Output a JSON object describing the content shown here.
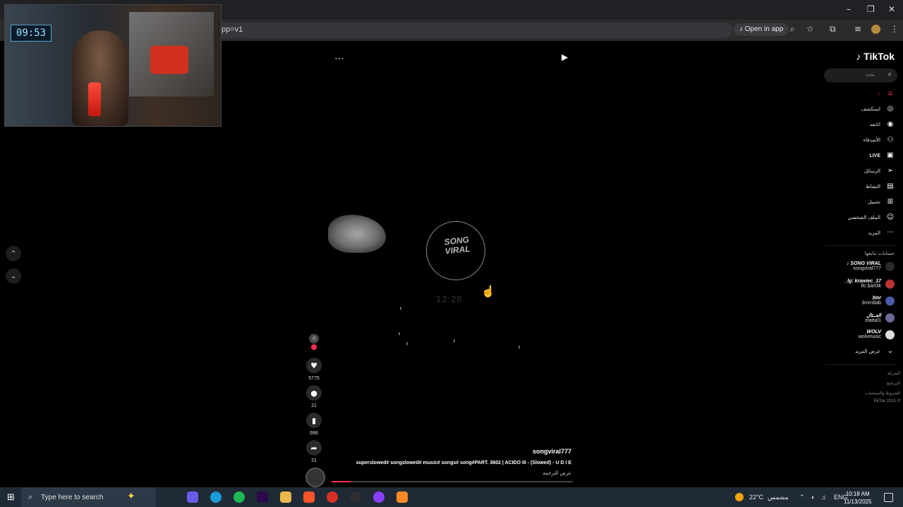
{
  "browser": {
    "url_fragment": "pp=v1",
    "open_in_app": "Open in app",
    "icons": [
      "tiktok-icon",
      "zoom-icon",
      "star-icon",
      "extensions-icon",
      "media-icon",
      "profile-icon",
      "menu-icon"
    ],
    "window_controls": [
      "–",
      "❐",
      "✕"
    ]
  },
  "webcam": {
    "clock": "09:53"
  },
  "video": {
    "logo_text": "SONG VIRAL",
    "faint_time": "12:28",
    "menu": "···",
    "progress": 0.08
  },
  "actions": {
    "like_count": "5775",
    "comment_count": "21",
    "save_count": "696",
    "share_count": "21"
  },
  "caption": {
    "username": "songviral777",
    "text": "superslowed# songslowed# music# songs# song#PART. 3602 | ACIDO III - (Slowed) - U D I E",
    "translate": "عرض الترجمة"
  },
  "sidebar": {
    "logo": "TikTok",
    "search_placeholder": "بحث",
    "nav": [
      {
        "label": "",
        "icon": "home-icon",
        "active": true
      },
      {
        "label": "استكشف",
        "icon": "compass-icon"
      },
      {
        "label": "اتابعه",
        "icon": "following-icon"
      },
      {
        "label": "الأصدقاء",
        "icon": "friends-icon"
      },
      {
        "label": "LIVE",
        "icon": "live-icon"
      },
      {
        "label": "الرسائل",
        "icon": "messages-icon"
      },
      {
        "label": "النشاط",
        "icon": "activity-icon"
      },
      {
        "label": "تحميل",
        "icon": "upload-icon"
      },
      {
        "label": "الملف الشخصي",
        "icon": "profile-icon"
      },
      {
        "label": "المزيد",
        "icon": "more-icon"
      }
    ],
    "following_title": "حسابات تتابعها",
    "accounts": [
      {
        "top": "♪ SONG VIRAL",
        "bottom": "songviral777"
      },
      {
        "top": "_lg: krawiec_17",
        "bottom": "lfc.bart3k"
      },
      {
        "top": "3mr",
        "bottom": "3mrrdiab"
      },
      {
        "top": "العــتال",
        "bottom": "elattal1"
      },
      {
        "top": "WOLV",
        "bottom": "wolvmusic"
      }
    ],
    "see_more": "عرض المزيد",
    "footer": [
      "الشركة",
      "البرنامج",
      "الشروط والسياسات",
      "TikTok 2025 ©"
    ]
  },
  "taskbar": {
    "search_text": "Type here to search",
    "weather": "22°C",
    "weather_label": "مشمس",
    "lang": "ENG",
    "time": "10:18 AM",
    "date": "11/13/2025",
    "apps": [
      {
        "name": "taskview-icon",
        "color": "#1f2a36"
      },
      {
        "name": "copilot-icon",
        "color": "#6b5ce7"
      },
      {
        "name": "edge-icon",
        "color": "#1c9bd6"
      },
      {
        "name": "spotify-icon",
        "color": "#1db954"
      },
      {
        "name": "premiere-icon",
        "color": "#2a0a4a"
      },
      {
        "name": "explorer-icon",
        "color": "#e8b84a"
      },
      {
        "name": "brave-icon",
        "color": "#fb542b"
      },
      {
        "name": "chrome-icon",
        "color": "#d93025"
      },
      {
        "name": "obs-icon",
        "color": "#302e31"
      },
      {
        "name": "messenger-icon",
        "color": "#8a3ffc"
      },
      {
        "name": "sublime-icon",
        "color": "#ff8a25"
      }
    ]
  }
}
